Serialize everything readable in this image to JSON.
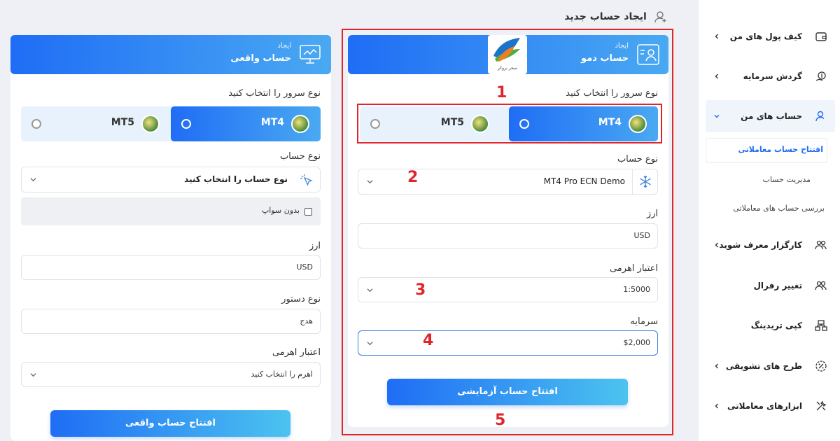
{
  "page": {
    "title": "ایجاد حساب جدید"
  },
  "demo": {
    "header_small": "ایجاد",
    "header_big": "حساب دمو",
    "logo_caption": "سحر بروکر",
    "server_label": "نوع سرور را انتخاب کنید",
    "mt4": "MT4",
    "mt5": "MT5",
    "account_type_label": "نوع حساب",
    "account_type_value": "MT4 Pro ECN Demo",
    "currency_label": "ارز",
    "currency_value": "USD",
    "leverage_label": "اعتبار اهرمی",
    "leverage_value": "1:5000",
    "capital_label": "سرمایه",
    "capital_value": "$2,000",
    "button": "افتتاح حساب آزمایشی"
  },
  "real": {
    "header_small": "ایجاد",
    "header_big": "حساب واقعی",
    "server_label": "نوع سرور را انتخاب کنید",
    "mt4": "MT4",
    "mt5": "MT5",
    "account_type_label": "نوع حساب",
    "account_type_placeholder": "نوع حساب را انتخاب کنید",
    "no_swap": "بدون سواپ",
    "currency_label": "ارز",
    "currency_value": "USD",
    "order_type_label": "نوع دستور",
    "order_type_value": "هدج",
    "leverage_label": "اعتبار اهرمی",
    "leverage_placeholder": "اهرم را انتخاب کنید",
    "button": "افتتاح حساب واقعی"
  },
  "annotations": [
    "1",
    "2",
    "3",
    "4",
    "5"
  ],
  "sidebar": {
    "items": [
      {
        "label": "کیف پول های من",
        "icon": "wallet-icon"
      },
      {
        "label": "گردش سرمایه",
        "icon": "money-flow-icon"
      },
      {
        "label": "حساب های من",
        "icon": "user-account-icon"
      },
      {
        "label": "کارگزار معرف شوید",
        "icon": "users-icon"
      },
      {
        "label": "تغییر رفرال",
        "icon": "users-swap-icon"
      },
      {
        "label": "کپی تریدینگ",
        "icon": "copy-trading-icon"
      },
      {
        "label": "طرح های تشویقی",
        "icon": "discount-icon"
      },
      {
        "label": "ابزارهای معاملاتی",
        "icon": "tools-icon"
      }
    ],
    "sub_items": [
      "افتتاح حساب معاملاتی",
      "مدیریت حساب",
      "بررسی حساب های معاملاتی"
    ]
  },
  "colors": {
    "accent": "#1f6df5",
    "accent_light": "#4aa9f2",
    "annotation_red": "#e0262d",
    "active_sub": "#1f6df5"
  }
}
